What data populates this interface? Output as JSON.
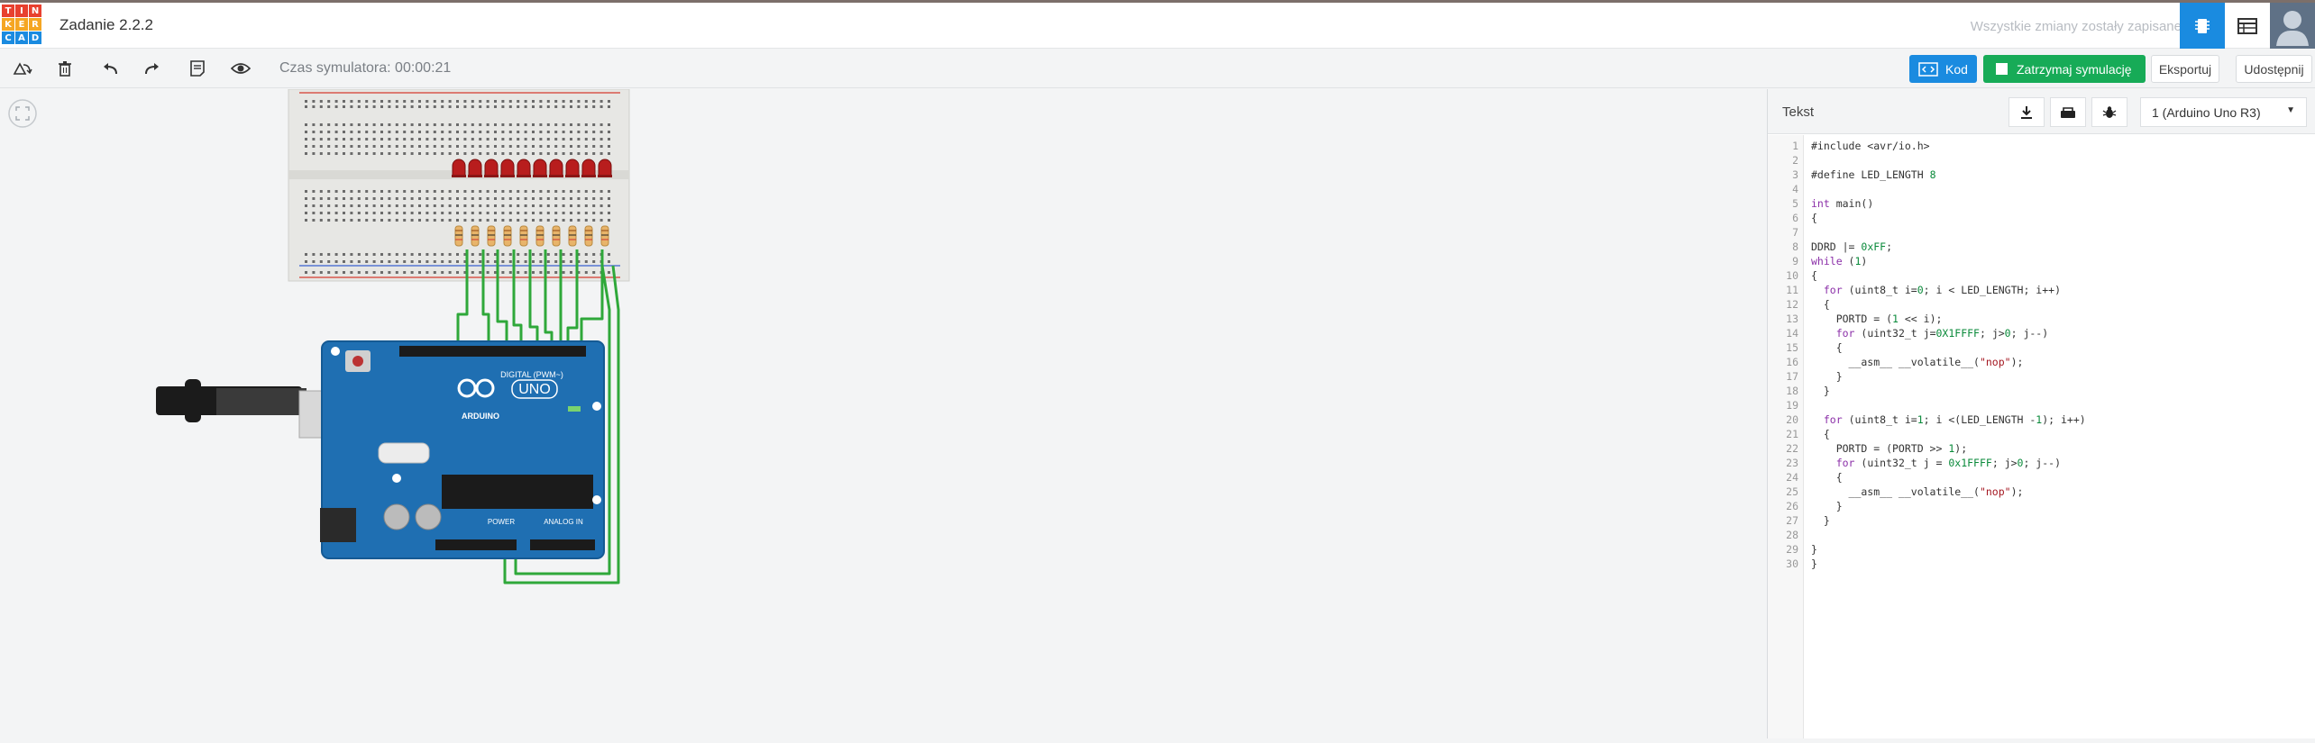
{
  "app": {
    "logo_letters": [
      "T",
      "I",
      "N",
      "K",
      "E",
      "R",
      "C",
      "A",
      "D"
    ],
    "logo_colors": [
      "#e8402f",
      "#e8402f",
      "#e8402f",
      "#f5a623",
      "#f5a623",
      "#f5a623",
      "#1a8be0",
      "#1a8be0",
      "#1a8be0"
    ],
    "project_title": "Zadanie 2.2.2",
    "save_status": "Wszystkie zmiany zostały zapisane"
  },
  "toolbar": {
    "sim_time": "Czas symulatora: 00:00:21",
    "code_label": "Kod",
    "stop_label": "Zatrzymaj symulację",
    "export_label": "Eksportuj",
    "share_label": "Udostępnij"
  },
  "board": {
    "uno_label": "UNO",
    "arduino_label": "ARDUINO",
    "digital_label": "DIGITAL (PWM~)",
    "power_label": "POWER",
    "analog_label": "ANALOG IN"
  },
  "code_panel": {
    "mode_label": "Tekst",
    "board_selected": "1 (Arduino Uno R3)",
    "lines": [
      "#include <avr/io.h>",
      "",
      "#define LED_LENGTH 8",
      "",
      "int main()",
      "{",
      "",
      "DDRD |= 0xFF;",
      "while (1)",
      "{",
      "  for (uint8_t i=0; i < LED_LENGTH; i++)",
      "  {",
      "    PORTD = (1 << i);",
      "    for (uint32_t j=0X1FFFF; j>0; j--)",
      "    {",
      "      __asm__ __volatile__(\"nop\");",
      "    }",
      "  }",
      "",
      "  for (uint8_t i=1; i <(LED_LENGTH -1); i++)",
      "  {",
      "    PORTD = (PORTD >> 1);",
      "    for (uint32_t j = 0x1FFFF; j>0; j--)",
      "    {",
      "      __asm__ __volatile__(\"nop\");",
      "    }",
      "  }",
      "",
      "}",
      "}"
    ]
  }
}
